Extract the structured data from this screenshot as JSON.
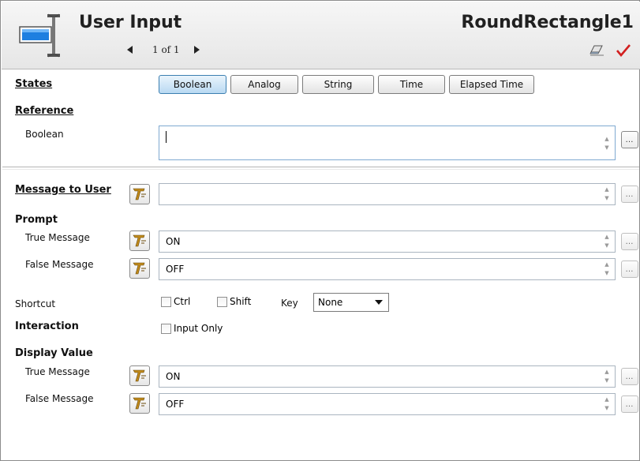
{
  "header": {
    "title": "User Input",
    "object_name": "RoundRectangle1",
    "pager": "1 of 1",
    "icon": "user-input-textfield-icon",
    "actions": [
      "eraser-icon",
      "checkmark-icon"
    ]
  },
  "states": {
    "label": "States",
    "buttons": [
      "Boolean",
      "Analog",
      "String",
      "Time",
      "Elapsed Time"
    ],
    "active": "Boolean"
  },
  "reference": {
    "label": "Reference",
    "boolean_label": "Boolean",
    "boolean_value": ""
  },
  "message_to_user": {
    "label": "Message to User",
    "value": ""
  },
  "prompt": {
    "label": "Prompt",
    "true_label": "True Message",
    "true_value": "ON",
    "false_label": "False Message",
    "false_value": "OFF"
  },
  "shortcut": {
    "label": "Shortcut",
    "ctrl": "Ctrl",
    "shift": "Shift",
    "key_label": "Key",
    "key_value": "None"
  },
  "interaction": {
    "label": "Interaction",
    "input_only": "Input Only"
  },
  "display_value": {
    "label": "Display Value",
    "true_label": "True Message",
    "true_value": "ON",
    "false_label": "False Message",
    "false_value": "OFF"
  },
  "colors": {
    "active_button": "#b9d9f2",
    "check_mark": "#d21f1f",
    "t_icon": "#c08a1c"
  }
}
